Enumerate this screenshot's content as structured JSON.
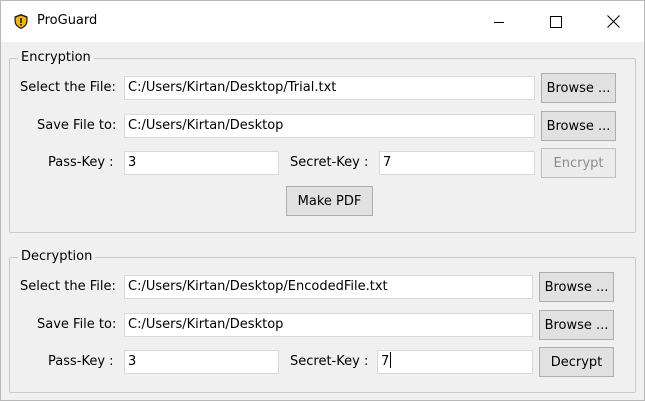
{
  "window": {
    "title": "ProGuard"
  },
  "encryption": {
    "legend": "Encryption",
    "select_label": "Select the File:",
    "select_value": "C:/Users/Kirtan/Desktop/Trial.txt",
    "save_label": "Save File to:",
    "save_value": "C:/Users/Kirtan/Desktop",
    "browse1": "Browse ...",
    "browse2": "Browse ...",
    "passkey_label": "Pass-Key :",
    "passkey_value": "3",
    "secret_label": "Secret-Key :",
    "secret_value": "7",
    "encrypt_button": "Encrypt",
    "makepdf_button": "Make PDF"
  },
  "decryption": {
    "legend": "Decryption",
    "select_label": "Select the File:",
    "select_value": "C:/Users/Kirtan/Desktop/EncodedFile.txt",
    "save_label": "Save File to:",
    "save_value": "C:/Users/Kirtan/Desktop",
    "browse1": "Browse ...",
    "browse2": "Browse ...",
    "passkey_label": "Pass-Key :",
    "passkey_value": "3",
    "secret_label": "Secret-Key :",
    "secret_value": "7",
    "decrypt_button": "Decrypt"
  }
}
